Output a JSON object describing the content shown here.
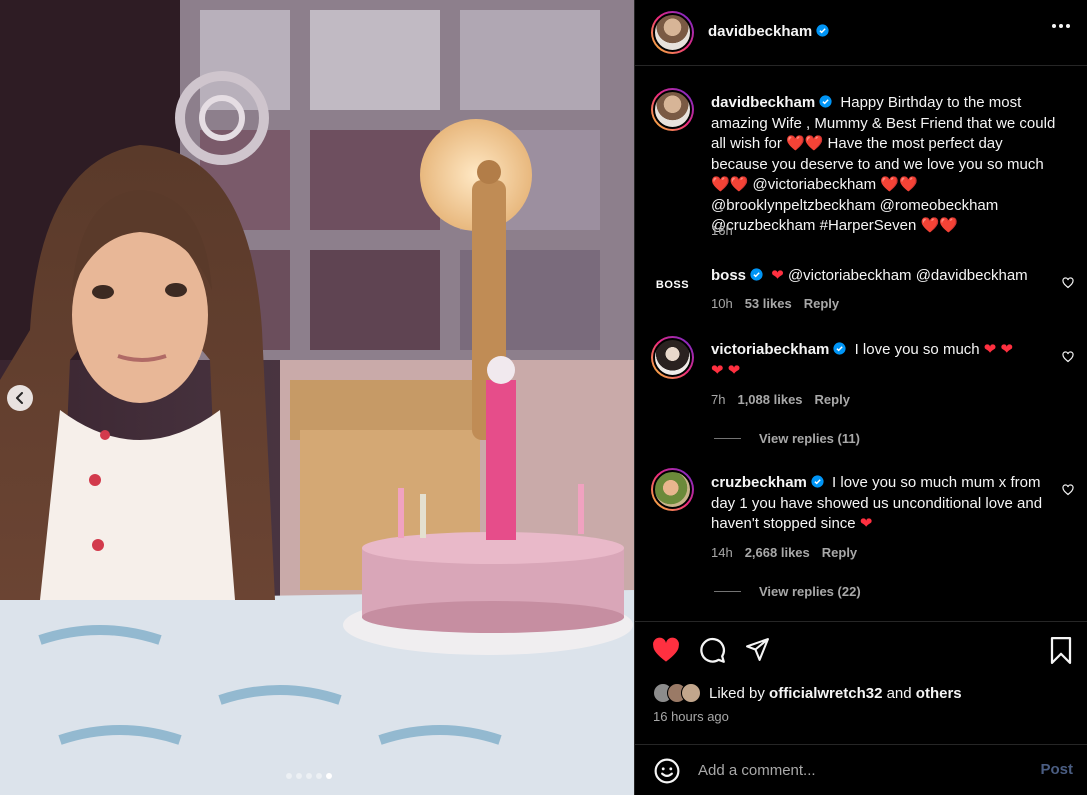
{
  "post": {
    "author": "davidbeckham",
    "verified": true,
    "more_icon": "more-horizontal-icon"
  },
  "photo": {
    "carousel": {
      "count": 5,
      "active_index": 4
    }
  },
  "caption": {
    "username": "davidbeckham",
    "text": "Happy Birthday to the most amazing Wife , Mummy & Best Friend that we could all wish for ❤️❤️ Have the most perfect day because you deserve to and we love you so much ❤️❤️ @victoriabeckham ❤️❤️ @brooklynpeltzbeckham @romeobeckham @cruzbeckham #HarperSeven ❤️❤️",
    "time": "16h"
  },
  "comments": [
    {
      "username": "boss",
      "avatar_text": "BOSS",
      "text": "@victoriabeckham @davidbeckham",
      "time": "10h",
      "likes": "53 likes",
      "reply": "Reply"
    },
    {
      "username": "victoriabeckham",
      "text": "I love you so much",
      "hearts_line2": "❤ ❤",
      "time": "7h",
      "likes": "1,088 likes",
      "reply": "Reply",
      "view_replies": "View replies (11)"
    },
    {
      "username": "cruzbeckham",
      "text": "I love you so much mum x from day 1 you have showed us unconditional love and haven't stopped since",
      "time": "14h",
      "likes": "2,668 likes",
      "reply": "Reply",
      "view_replies": "View replies (22)"
    }
  ],
  "actions": {
    "like_icon": "heart-filled-icon",
    "comment_icon": "comment-icon",
    "share_icon": "share-icon",
    "save_icon": "bookmark-icon"
  },
  "likes": {
    "prefix": "Liked by",
    "user": "officialwretch32",
    "and": "and",
    "others": "others"
  },
  "post_time": "16 hours ago",
  "add_comment": {
    "placeholder": "Add a comment...",
    "post_label": "Post"
  },
  "colors": {
    "background": "#000000",
    "text": "#f5f5f5",
    "secondary_text": "#a8a8a8",
    "like_red": "#ff3040",
    "verified_blue": "#0095f6",
    "post_button_disabled": "#4a5d82"
  }
}
